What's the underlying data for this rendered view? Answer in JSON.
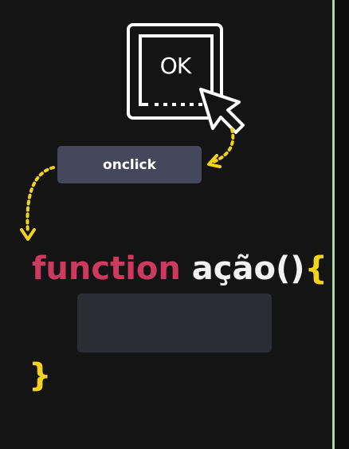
{
  "button_icon": {
    "label": "OK"
  },
  "event": {
    "label": "onclick"
  },
  "code": {
    "keyword": "function",
    "name": "ação()",
    "open_brace": "{",
    "close_brace": "}"
  },
  "colors": {
    "background": "#141414",
    "keyword": "#cc3a60",
    "brace": "#f2d21c",
    "arrow": "#f2d21c",
    "event_box": "#45475a",
    "body_box": "#2b2d34",
    "divider": "#a9d9a6"
  },
  "icons": [
    "button-icon",
    "cursor-arrow-icon",
    "dotted-arrow-icon"
  ]
}
